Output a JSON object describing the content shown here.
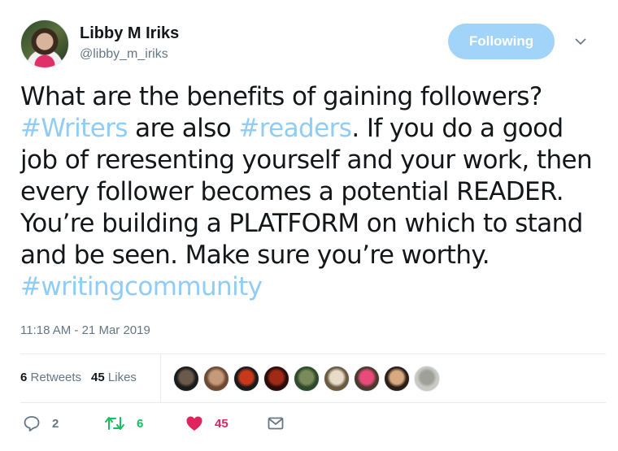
{
  "author": {
    "name": "Libby M Iriks",
    "handle": "@libby_m_iriks",
    "avatar_icon": "profile-photo"
  },
  "follow_button": {
    "label": "Following",
    "color": "#a2d3f9"
  },
  "menu_caret_icon": "chevron-down-icon",
  "tweet": {
    "segments": [
      {
        "type": "text",
        "text": "What are the benefits of gaining followers? "
      },
      {
        "type": "hashtag",
        "text": "#Writers"
      },
      {
        "type": "text",
        "text": " are also "
      },
      {
        "type": "hashtag",
        "text": "#readers"
      },
      {
        "type": "text",
        "text": ". If you do a good job of reresenting yourself and your work, then every follower becomes a potential READER. You’re building a PLATFORM on which to stand and be seen. Make sure you’re worthy. "
      },
      {
        "type": "hashtag",
        "text": "#writingcommunity"
      }
    ],
    "hashtag_color": "#8fccf6",
    "timestamp": "11:18 AM - 21 Mar 2019"
  },
  "stats": {
    "retweets_count": "6",
    "retweets_label": "Retweets",
    "likes_count": "45",
    "likes_label": "Likes"
  },
  "likers": [
    {
      "name": "liker-1",
      "colors": [
        "#1b1b1b",
        "#6b5a4c"
      ]
    },
    {
      "name": "liker-2",
      "colors": [
        "#6e4a32",
        "#c59a7a"
      ]
    },
    {
      "name": "liker-3",
      "colors": [
        "#1a1a1a",
        "#c8381a"
      ]
    },
    {
      "name": "liker-4",
      "colors": [
        "#2a0c08",
        "#a02a16"
      ]
    },
    {
      "name": "liker-5",
      "colors": [
        "#2f4a2a",
        "#7a8a5a"
      ]
    },
    {
      "name": "liker-6",
      "colors": [
        "#6a5a40",
        "#e8dcc8"
      ]
    },
    {
      "name": "liker-7",
      "colors": [
        "#4a3a2e",
        "#e84a7a"
      ]
    },
    {
      "name": "liker-8",
      "colors": [
        "#2a1e16",
        "#d8a880"
      ]
    },
    {
      "name": "liker-9",
      "colors": [
        "#c8c8c4",
        "#a0a09a"
      ]
    }
  ],
  "actions": {
    "reply": {
      "count": "2",
      "color": "#657786"
    },
    "retweet": {
      "count": "6",
      "color": "#17bf63"
    },
    "like": {
      "count": "45",
      "color": "#e0245e"
    },
    "message": {
      "color": "#657786"
    }
  }
}
